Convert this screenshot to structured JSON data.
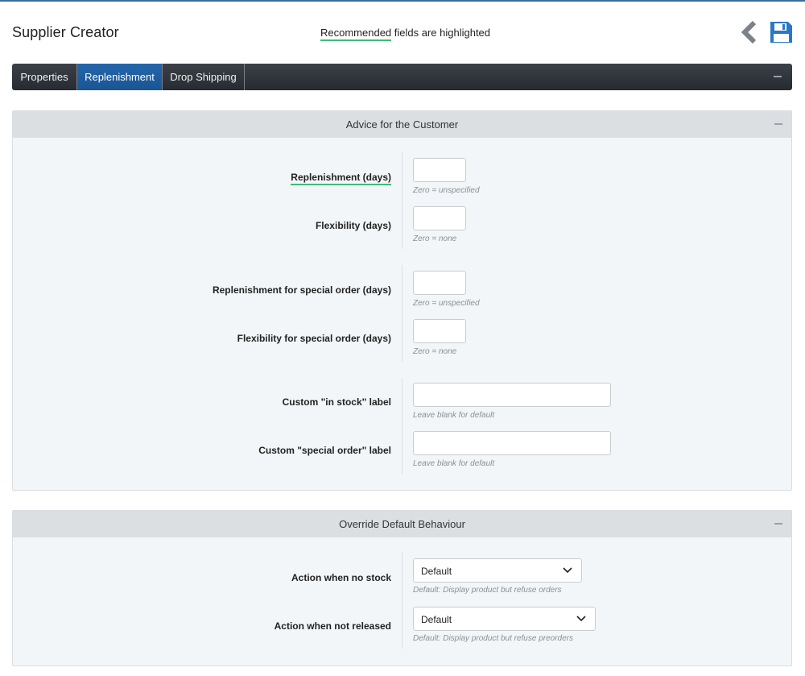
{
  "header": {
    "title": "Supplier Creator",
    "recommend_highlight": "Recommended",
    "recommend_rest": " fields are highlighted"
  },
  "tabs": [
    {
      "label": "Properties",
      "active": false
    },
    {
      "label": "Replenishment",
      "active": true
    },
    {
      "label": "Drop Shipping",
      "active": false
    }
  ],
  "sections": {
    "advice": {
      "title": "Advice for the Customer",
      "fields": [
        {
          "label": "Replenishment (days)",
          "hint": "Zero = unspecified",
          "value": "",
          "recommended": true
        },
        {
          "label": "Flexibility (days)",
          "hint": "Zero = none",
          "value": ""
        },
        {
          "label": "Replenishment for special order (days)",
          "hint": "Zero = unspecified",
          "value": ""
        },
        {
          "label": "Flexibility for special order (days)",
          "hint": "Zero = none",
          "value": ""
        },
        {
          "label": "Custom \"in stock\" label",
          "hint": "Leave blank for default",
          "value": ""
        },
        {
          "label": "Custom \"special order\" label",
          "hint": "Leave blank for default",
          "value": ""
        }
      ]
    },
    "override": {
      "title": "Override Default Behaviour",
      "fields": [
        {
          "label": "Action when no stock",
          "selected": "Default",
          "hint": "Default: Display product but refuse orders"
        },
        {
          "label": "Action when not released",
          "selected": "Default",
          "hint": "Default: Display product but refuse preorders"
        }
      ]
    }
  },
  "colors": {
    "accent": "#1a5594",
    "recommended_underline": "#3dbb79",
    "toolbar_dark": "#262a31"
  },
  "icons": {
    "back": "chevron-left-icon",
    "save": "floppy-disk-icon"
  }
}
